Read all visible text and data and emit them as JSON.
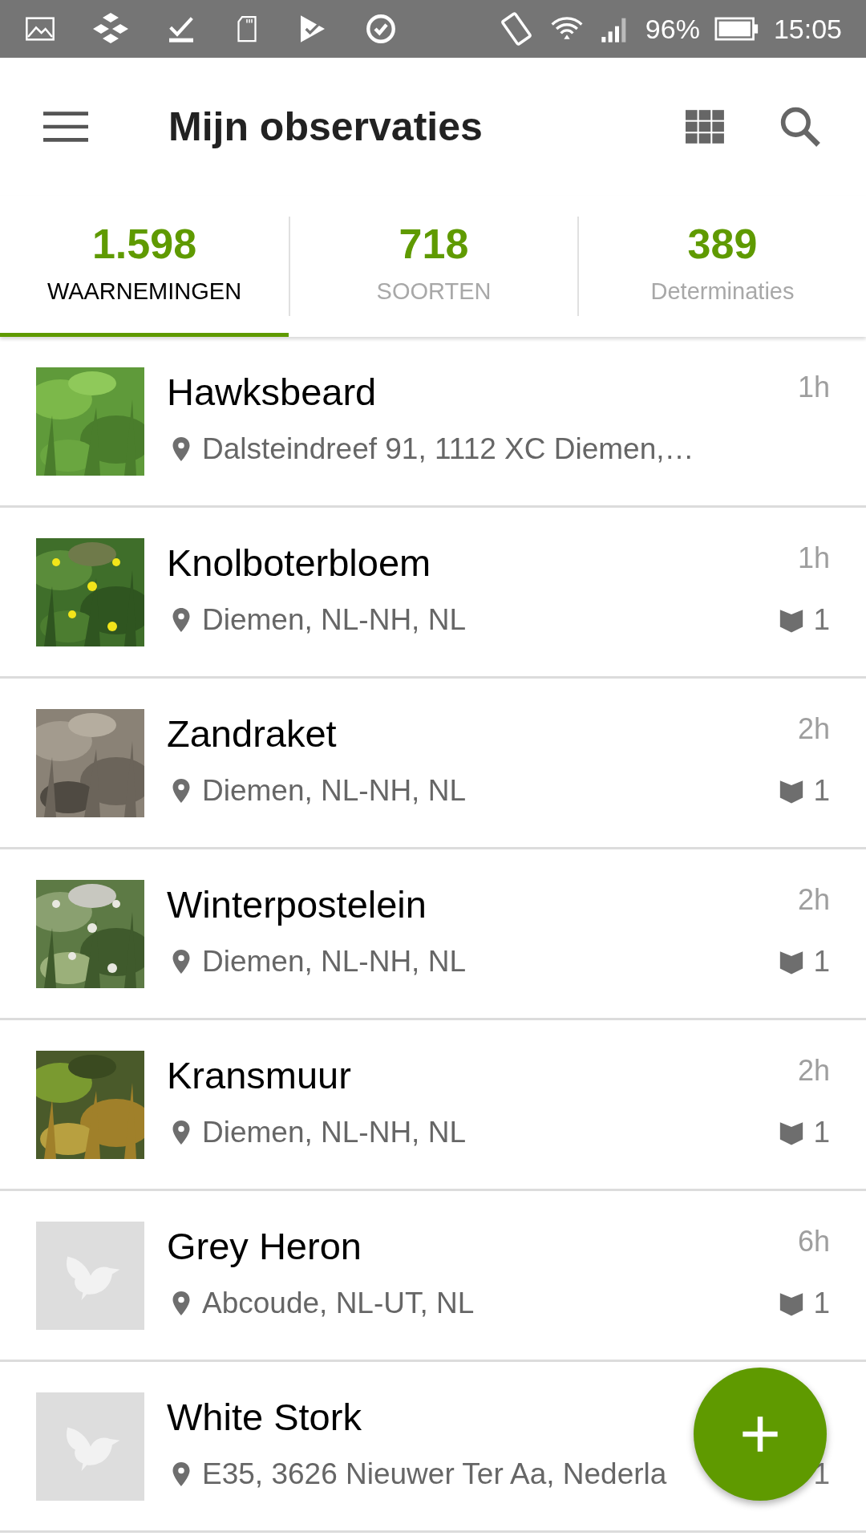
{
  "status_bar": {
    "battery": "96%",
    "time": "15:05"
  },
  "app_bar": {
    "title": "Mijn observaties"
  },
  "tabs": [
    {
      "count": "1.598",
      "label": "WAARNEMINGEN",
      "selected": true
    },
    {
      "count": "718",
      "label": "SOORTEN",
      "selected": false
    },
    {
      "count": "389",
      "label": "Determinaties",
      "selected": false
    }
  ],
  "observations": [
    {
      "kind": "picture",
      "name": "Hawksbeard",
      "location": "Dalsteindreef 91, 1112 XC Diemen,…",
      "time": "1h"
    },
    {
      "kind": "picture",
      "name": "Knolboterbloem",
      "location": "Diemen, NL-NH, NL",
      "time": "1h",
      "count": "1"
    },
    {
      "kind": "picture",
      "name": "Zandraket",
      "location": "Diemen, NL-NH, NL",
      "time": "2h",
      "count": "1"
    },
    {
      "kind": "picture",
      "name": "Winterpostelein",
      "location": "Diemen, NL-NH, NL",
      "time": "2h",
      "count": "1"
    },
    {
      "kind": "picture",
      "name": "Kransmuur",
      "location": "Diemen, NL-NH, NL",
      "time": "2h",
      "count": "1"
    },
    {
      "kind": "placeholder",
      "name": "Grey Heron",
      "location": "Abcoude, NL-UT, NL",
      "time": "6h",
      "count": "1"
    },
    {
      "kind": "placeholder",
      "name": "White Stork",
      "location": "E35, 3626 Nieuwer Ter Aa, Nederla",
      "count": "1",
      "covered": true
    }
  ]
}
